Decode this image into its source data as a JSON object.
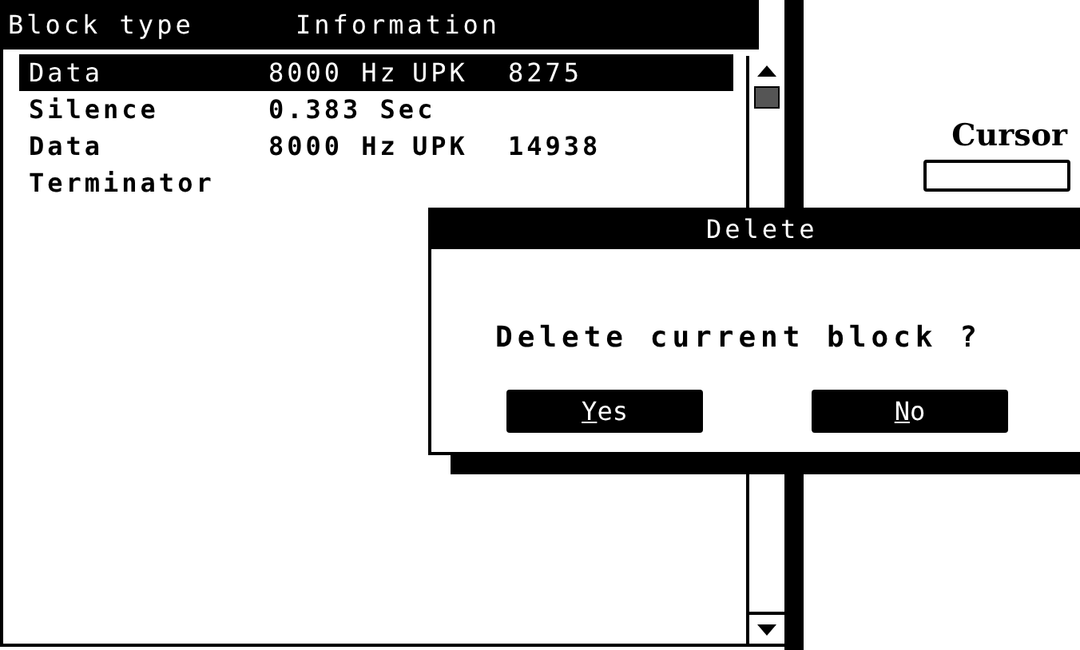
{
  "list": {
    "columns": [
      "Block type",
      "Information"
    ],
    "rows": [
      {
        "type": "Data",
        "info": [
          "8000 Hz",
          "UPK",
          "8275"
        ],
        "selected": true
      },
      {
        "type": "Silence",
        "info": [
          "0.383 Sec"
        ],
        "selected": false
      },
      {
        "type": "Data",
        "info": [
          "8000 Hz",
          "UPK",
          "14938"
        ],
        "selected": false
      },
      {
        "type": "Terminator",
        "info": [],
        "selected": false
      }
    ]
  },
  "cursor": {
    "label": "Cursor"
  },
  "dialog": {
    "title": "Delete",
    "message": "Delete current block ?",
    "buttons": [
      {
        "key": "Y",
        "rest": "es"
      },
      {
        "key": "N",
        "rest": "o"
      }
    ]
  }
}
